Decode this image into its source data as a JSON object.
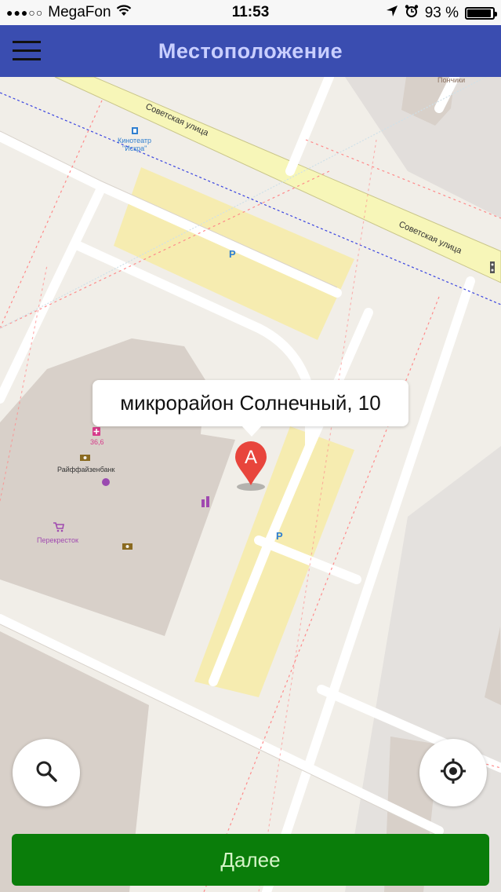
{
  "status_bar": {
    "signal": "●●●○○",
    "carrier": "MegaFon",
    "time": "11:53",
    "battery_text": "93 %",
    "battery_level": 0.93
  },
  "nav": {
    "title": "Местоположение"
  },
  "map": {
    "labels": {
      "street_1": "Советская улица",
      "street_2": "Советская улица",
      "cinema_line1": "Кинотеатр",
      "cinema_line2": "\"Искра\"",
      "top_right": "Пончики",
      "parking_1": "P",
      "parking_2": "P",
      "pharmacy": "36,6",
      "bank": "Райффайзенбанк",
      "supermarket": "Перекресток"
    },
    "marker_letter": "A",
    "callout": "микрорайон Солнечный, 10"
  },
  "actions": {
    "next_label": "Далее"
  },
  "colors": {
    "navbar": "#3a4db0",
    "navbar_title": "#c9cfff",
    "next_button": "#0a7d0a",
    "marker": "#e8453c",
    "parking_area": "#f6ecb0",
    "building": "#d8d0c9"
  }
}
